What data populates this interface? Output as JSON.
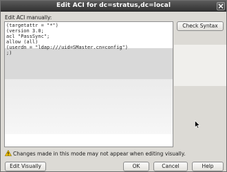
{
  "window": {
    "title": "Edit ACI for dc=stratus,dc=local"
  },
  "editor": {
    "label": "Edit ACI manually:",
    "lines": [
      "(targetattr = \"*\")",
      "(version 3.0;",
      "acl \"PassSync\";",
      "allow (all)",
      "(userdn = \"ldap:///uid=SMaster.cn=config\")",
      ";)"
    ]
  },
  "buttons": {
    "check_syntax": "Check Syntax",
    "edit_visually": "Edit Visually",
    "ok": "OK",
    "cancel": "Cancel",
    "help": "Help"
  },
  "warning": {
    "text": "Changes made in this mode may not appear when editing visually."
  },
  "colors": {
    "titlebar": "#3c3c3c",
    "dialog_bg": "#dcdad5",
    "warning_icon": "#f2c200"
  }
}
